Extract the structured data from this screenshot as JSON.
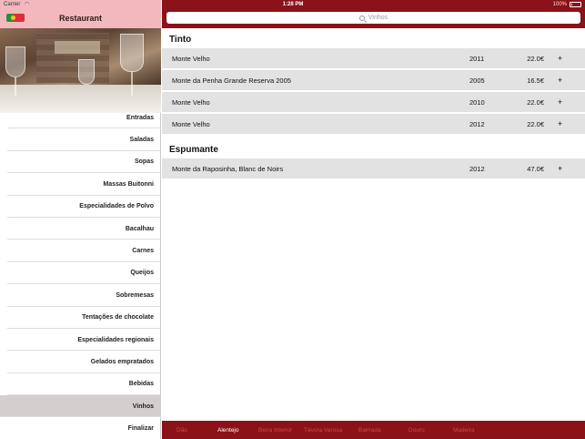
{
  "status_bar": {
    "carrier": "Carrier",
    "time": "1:28 PM",
    "battery": "100%"
  },
  "sidebar": {
    "title": "Restaurant",
    "items": [
      {
        "label": "Entradas"
      },
      {
        "label": "Saladas"
      },
      {
        "label": "Sopas"
      },
      {
        "label": "Massas Buitonni"
      },
      {
        "label": "Especialidades de Polvo"
      },
      {
        "label": "Bacalhau"
      },
      {
        "label": "Carnes"
      },
      {
        "label": "Queijos"
      },
      {
        "label": "Sobremesas"
      },
      {
        "label": "Tentações de chocolate"
      },
      {
        "label": "Especialidades regionais"
      },
      {
        "label": "Gelados empratados"
      },
      {
        "label": "Bebidas"
      },
      {
        "label": "Vinhos",
        "selected": true
      },
      {
        "label": "Finalizar"
      }
    ]
  },
  "search": {
    "placeholder": "Vinhos"
  },
  "wine_sections": [
    {
      "title": "Tinto",
      "wines": [
        {
          "name": "Monte Velho",
          "year": "2011",
          "price": "22.0€",
          "add": "+"
        },
        {
          "name": "Monte da Penha Grande Reserva 2005",
          "year": "2005",
          "price": "16.5€",
          "add": "+"
        },
        {
          "name": "Monte Velho",
          "year": "2010",
          "price": "22.0€",
          "add": "+"
        },
        {
          "name": "Monte Velho",
          "year": "2012",
          "price": "22.0€",
          "add": "+"
        }
      ]
    },
    {
      "title": "Espumante",
      "wines": [
        {
          "name": "Monte da Raposinha, Blanc de Noirs",
          "year": "2012",
          "price": "47.0€",
          "add": "+"
        }
      ]
    }
  ],
  "regions": [
    {
      "label": "Dão"
    },
    {
      "label": "Alentejo",
      "active": true
    },
    {
      "label": "Beira Interior"
    },
    {
      "label": "Távora Varosa"
    },
    {
      "label": "Bairrada"
    },
    {
      "label": "Douro"
    },
    {
      "label": "Madeira"
    }
  ],
  "colors": {
    "brand_red": "#8b1219",
    "header_pink": "#f2b8bd",
    "selected_gray": "#d3cfcf",
    "row_gray": "#e2e2e2",
    "inactive_region": "#d8444c"
  },
  "icons": {
    "flag": "portugal-flag-icon",
    "search": "search-icon",
    "wifi": "wifi-icon",
    "battery": "battery-icon"
  }
}
